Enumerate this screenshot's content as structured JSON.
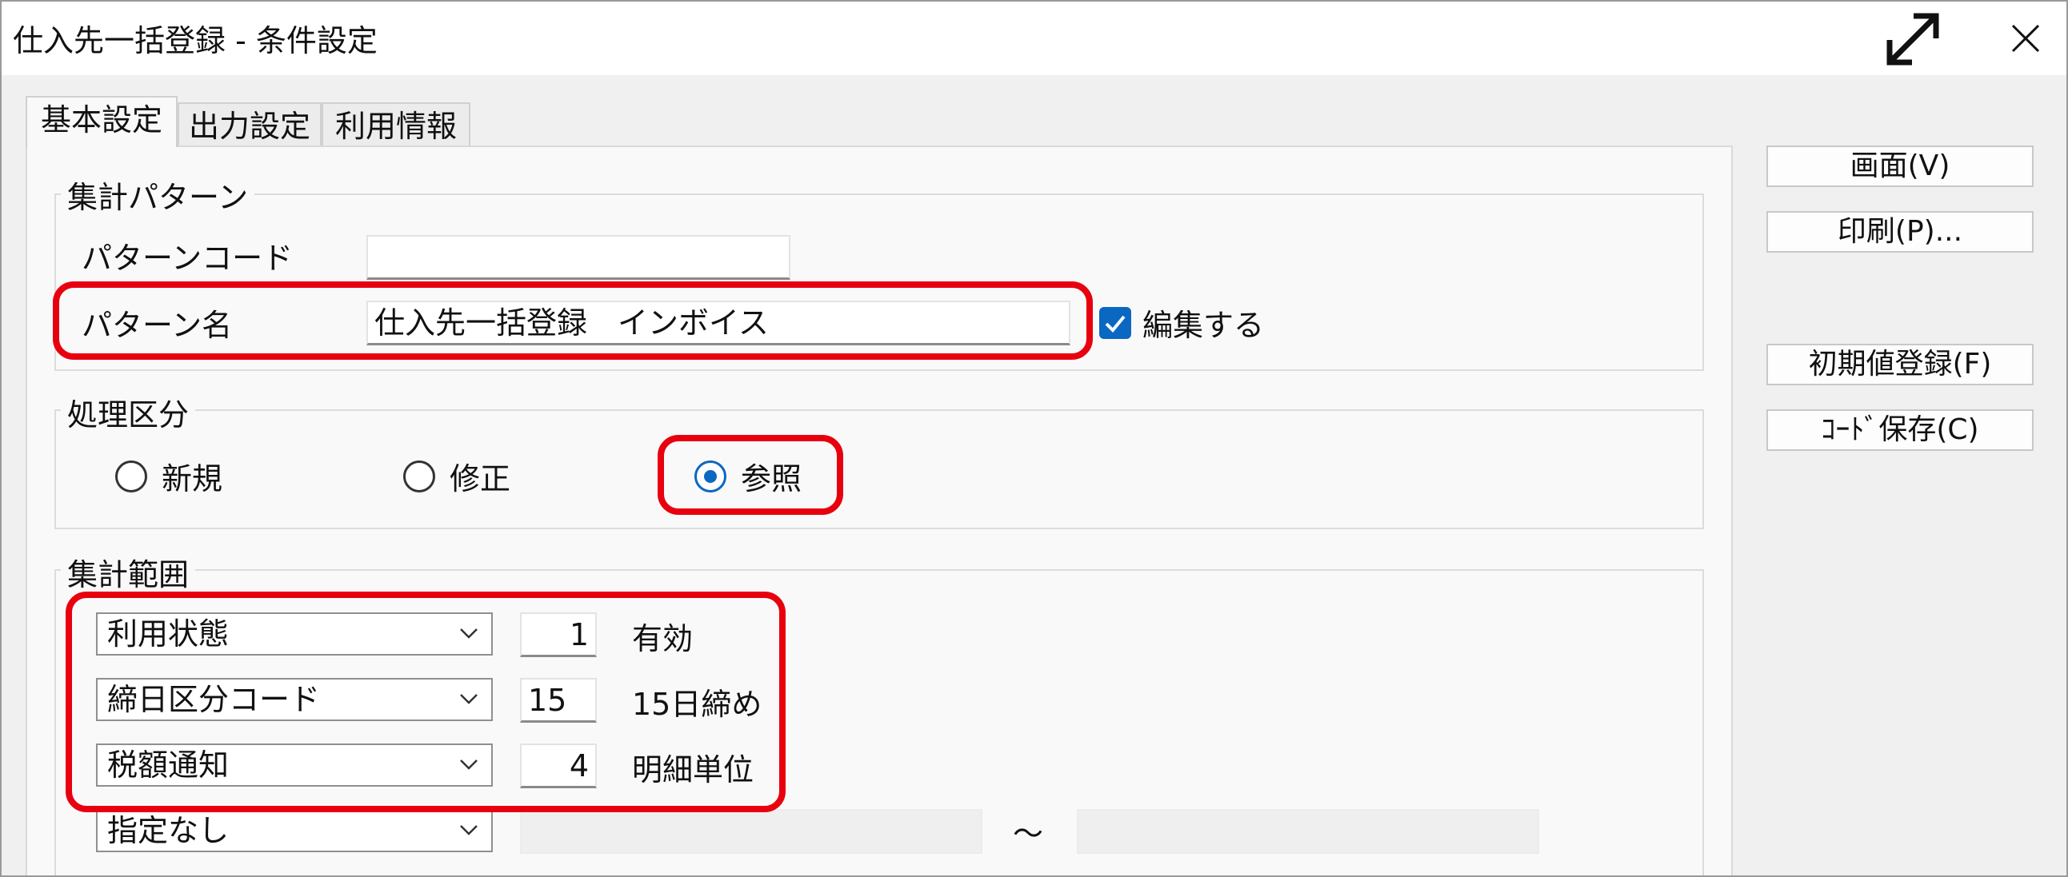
{
  "window": {
    "title": "仕入先一括登録 - 条件設定"
  },
  "tabs": [
    {
      "label": "基本設定"
    },
    {
      "label": "出力設定"
    },
    {
      "label": "利用情報"
    }
  ],
  "pattern": {
    "group_label": "集計パターン",
    "code_label": "パターンコード",
    "code_value": "",
    "name_label": "パターン名",
    "name_value": "仕入先一括登録　インボイス",
    "edit_label": "編集する"
  },
  "processing": {
    "group_label": "処理区分",
    "options": [
      {
        "label": "新規"
      },
      {
        "label": "修正"
      },
      {
        "label": "参照"
      }
    ]
  },
  "range": {
    "group_label": "集計範囲",
    "rows": [
      {
        "field": "利用状態",
        "value": "1",
        "desc": "有効"
      },
      {
        "field": "締日区分コード",
        "value": "15",
        "desc": "15日締め"
      },
      {
        "field": "税額通知",
        "value": "4",
        "desc": "明細単位"
      },
      {
        "field": "指定なし",
        "value": "",
        "desc": ""
      }
    ],
    "separator": "～"
  },
  "side_buttons": [
    {
      "label": "画面(V)"
    },
    {
      "label": "印刷(P)..."
    },
    {
      "label": "初期値登録(F)"
    },
    {
      "label": "ｺｰﾄﾞ保存(C)"
    }
  ],
  "colors": {
    "accent": "#0a67c2",
    "highlight": "#e8000f"
  }
}
